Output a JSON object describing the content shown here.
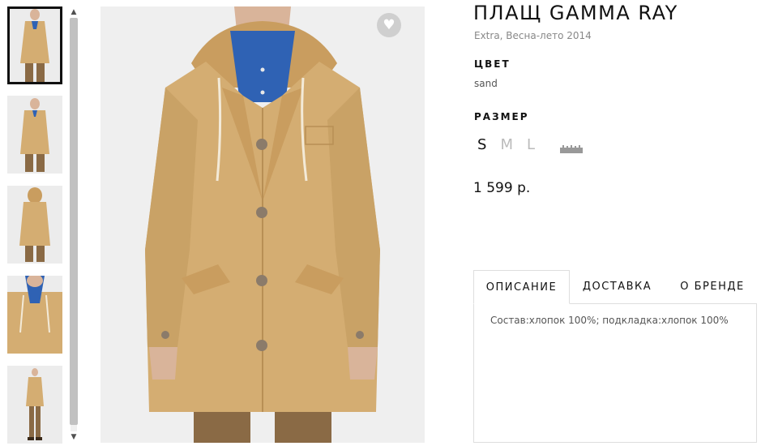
{
  "product": {
    "title": "ПЛАЩ GAMMA RAY",
    "subtitle": "Extra, Весна-лето 2014",
    "color_label": "ЦВЕТ",
    "color_value": "sand",
    "size_label": "РАЗМЕР",
    "sizes": [
      "S",
      "M",
      "L"
    ],
    "selected_size": "S",
    "price": "1 599 р."
  },
  "tabs": [
    {
      "label": "ОПИСАНИЕ",
      "active": true
    },
    {
      "label": "ДОСТАВКА",
      "active": false
    },
    {
      "label": "О БРЕНДЕ",
      "active": false
    }
  ],
  "description": "Состав:хлопок 100%; подкладка:хлопок 100%",
  "icons": {
    "favorite": "heart-icon",
    "size_guide": "ruler-icon",
    "scroll_up": "chevron-up-icon",
    "scroll_down": "chevron-down-icon"
  },
  "colors": {
    "coat": "#d4ad72",
    "shirt": "#2f62b4",
    "trousers": "#8a6a45",
    "image_bg": "#efefef"
  },
  "thumbnails": [
    "front",
    "front-side",
    "back",
    "detail",
    "full-length"
  ]
}
